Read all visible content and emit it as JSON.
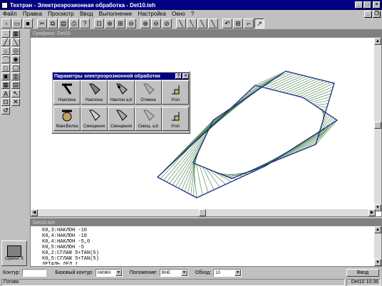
{
  "app": {
    "title": "Техтран - Электроэрозионная обработка - Det10.teh",
    "menu": [
      "Файл",
      "Правка",
      "Просмотр",
      "Ввод",
      "Выполнение",
      "Настройка",
      "Окно",
      "?"
    ]
  },
  "graphic_window": {
    "title": "Графика: Det10"
  },
  "params_dialog": {
    "title": "Параметры электроэрозионной обработки",
    "buttons": [
      "Наклона",
      "Наклона",
      "Наклон a,b",
      "Отмена",
      "Угол",
      "МаксВелка",
      "Смещения",
      "Смещения",
      "Смещ. a,b",
      "Угол"
    ]
  },
  "code_window": {
    "title": "Det10.teh",
    "lines": [
      "К0,3:НАКЛОН -10",
      "К0,4:НАКЛОН -10",
      "К0,4:НАКЛОН -5,0",
      "К0,5:НАКЛОН -5",
      "К0,2:СГЛАЖ 5+TAN(5)",
      "К0,5:СГЛАЖ 5+TAN(5)",
      "ДЕТАЛЬ ДЕЛ 1"
    ]
  },
  "left_panel": {
    "orient_label": "Ориент К"
  },
  "bottom_bar": {
    "contour_label": "Контур:",
    "contour_value": "",
    "base_label": "Базовый контур:",
    "base_value": "НИЖН",
    "position_label": "Положение:",
    "position_value": "ВНЕ",
    "bypass_label": "Обход:",
    "bypass_value": "10",
    "input_button": "Ввод"
  },
  "status_bar": {
    "status": "Готово",
    "file": "Det10",
    "time": "10:36"
  },
  "colors": {
    "titlebar": "#000080",
    "contour_line": "#1a2f8a",
    "hatch": "#3f7a3f"
  },
  "chart_data": {
    "type": "wireframe",
    "description_points": [
      "upper-contour",
      "lower-contour",
      "hatch-lines"
    ]
  }
}
